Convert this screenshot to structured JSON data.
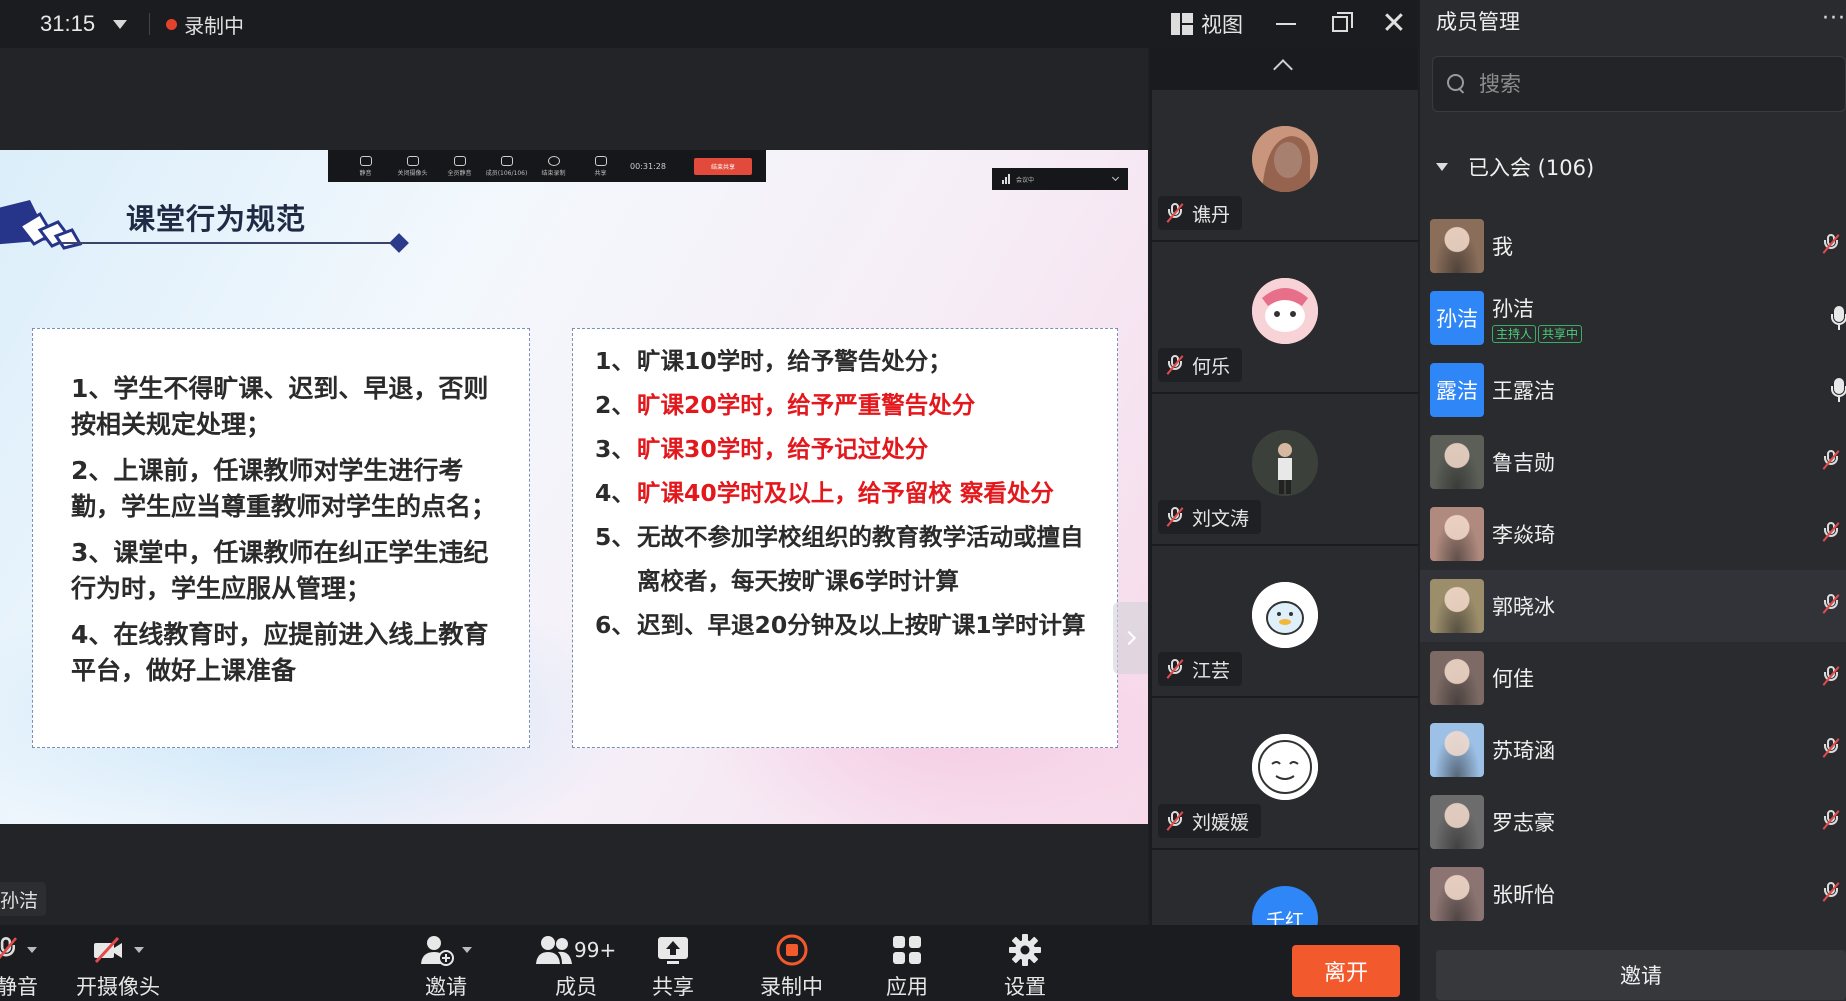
{
  "topbar": {
    "timer": "31:15",
    "recording": "录制中",
    "view_label": "视图"
  },
  "slide": {
    "title": "课堂行为规范",
    "left_items": [
      "1、学生不得旷课、迟到、早退，否则按相关规定处理；",
      "2、上课前，任课教师对学生进行考勤，学生应当尊重教师对学生的点名；",
      "3、课堂中，任课教师在纠正学生违纪行为时，学生应服从管理；",
      "4、在线教育时，应提前进入线上教育平台，做好上课准备"
    ],
    "right_items": [
      {
        "num": "1、",
        "text": "旷课10学时，给予警告处分；",
        "highlight": false
      },
      {
        "num": "2、",
        "text": "旷课20学时，给予严重警告处分",
        "highlight": true
      },
      {
        "num": "3、",
        "text": "旷课30学时，给予记过处分",
        "highlight": true
      },
      {
        "num": "4、",
        "text": "旷课40学时及以上，给予留校  察看处分",
        "highlight": true
      },
      {
        "num": "5、",
        "text": "无故不参加学校组织的教育教学活动或擅自离校者，每天按旷课6学时计算",
        "highlight": false
      },
      {
        "num": "6、",
        "text": "迟到、早退20分钟及以上按旷课1学时计算",
        "highlight": false
      }
    ],
    "mini_time": "00:31:28",
    "speaker_tag": "孙洁"
  },
  "gallery": [
    {
      "name": "谯丹"
    },
    {
      "name": "何乐"
    },
    {
      "name": "刘文涛"
    },
    {
      "name": "江芸"
    },
    {
      "name": "刘媛媛"
    },
    {
      "name": "千红"
    }
  ],
  "members": {
    "title": "成员管理",
    "search_placeholder": "搜索",
    "group_label": "已入会 (106)",
    "list": [
      {
        "name": "我",
        "avatar_text": "",
        "tags": [],
        "mic": "muted",
        "color": "#8a6e5a"
      },
      {
        "name": "孙洁",
        "avatar_text": "孙洁",
        "tags": [
          "主持人",
          "共享中"
        ],
        "mic": "on",
        "color": "#2f86f6"
      },
      {
        "name": "王露洁",
        "avatar_text": "露洁",
        "tags": [],
        "mic": "on",
        "color": "#2f86f6"
      },
      {
        "name": "鲁吉勋",
        "avatar_text": "",
        "tags": [],
        "mic": "muted",
        "color": "#5b5f57"
      },
      {
        "name": "李焱琦",
        "avatar_text": "",
        "tags": [],
        "mic": "muted",
        "color": "#b08a7e"
      },
      {
        "name": "郭晓冰",
        "avatar_text": "",
        "tags": [],
        "mic": "muted",
        "color": "#9c8d6b"
      },
      {
        "name": "何佳",
        "avatar_text": "",
        "tags": [],
        "mic": "muted",
        "color": "#7d6a64"
      },
      {
        "name": "苏琦涵",
        "avatar_text": "",
        "tags": [],
        "mic": "muted",
        "color": "#9cc0e6"
      },
      {
        "name": "罗志豪",
        "avatar_text": "",
        "tags": [],
        "mic": "muted",
        "color": "#6c6c6c"
      },
      {
        "name": "张昕怡",
        "avatar_text": "",
        "tags": [],
        "mic": "muted",
        "color": "#8b7471"
      }
    ],
    "invite_label": "邀请"
  },
  "toolbar": {
    "mute_label": "静音",
    "camera_label": "开摄像头",
    "invite_label": "邀请",
    "members_label": "成员",
    "members_badge": "99+",
    "share_label": "共享",
    "record_label": "录制中",
    "apps_label": "应用",
    "settings_label": "设置",
    "leave_label": "离开"
  },
  "colors": {
    "accent_blue": "#2f86f6",
    "leave_orange": "#f25a2e",
    "record_red": "#e3432b",
    "slide_red": "#e3181d",
    "tag_green": "#4cd07a"
  }
}
